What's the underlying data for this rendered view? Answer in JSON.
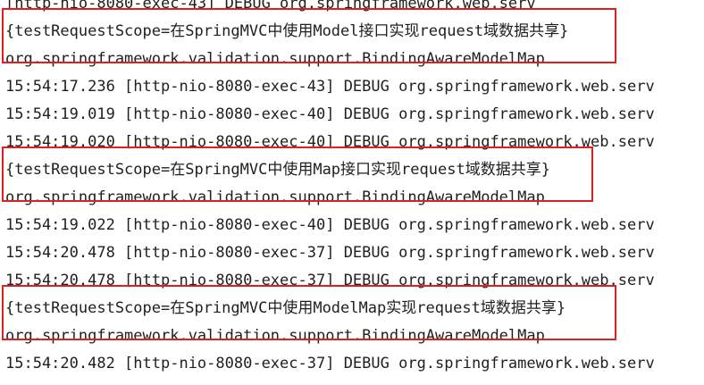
{
  "console": {
    "top_partial": "[http-nio-8080-exec-43] DEBUG org.springframework.web.serv",
    "lines": [
      "{testRequestScope=在SpringMVC中使用Model接口实现request域数据共享}",
      "org.springframework.validation.support.BindingAwareModelMap",
      "15:54:17.236 [http-nio-8080-exec-43] DEBUG org.springframework.web.serv",
      "15:54:19.019 [http-nio-8080-exec-40] DEBUG org.springframework.web.serv",
      "15:54:19.020 [http-nio-8080-exec-40] DEBUG org.springframework.web.serv",
      "{testRequestScope=在SpringMVC中使用Map接口实现request域数据共享}",
      "org.springframework.validation.support.BindingAwareModelMap",
      "15:54:19.022 [http-nio-8080-exec-40] DEBUG org.springframework.web.serv",
      "15:54:20.478 [http-nio-8080-exec-37] DEBUG org.springframework.web.serv",
      "15:54:20.478 [http-nio-8080-exec-37] DEBUG org.springframework.web.serv",
      "{testRequestScope=在SpringMVC中使用ModelMap实现request域数据共享}",
      "org.springframework.validation.support.BindingAwareModelMap",
      "15:54:20.482 [http-nio-8080-exec-37] DEBUG org.springframework.web.serv"
    ]
  },
  "colors": {
    "text": "#1f1f1f",
    "highlight_border": "#e02020",
    "background": "#ffffff"
  }
}
